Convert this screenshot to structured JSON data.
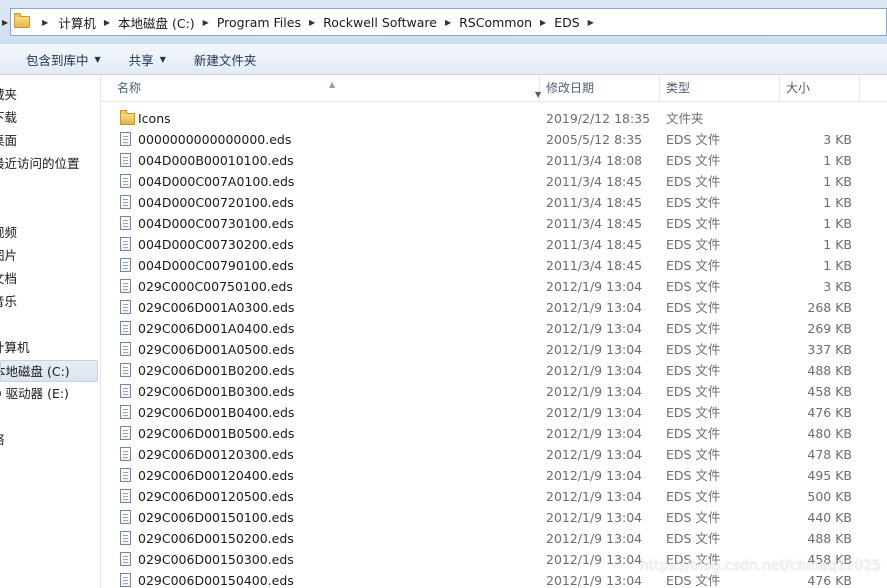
{
  "address": {
    "crumbs": [
      "计算机",
      "本地磁盘 (C:)",
      "Program Files",
      "Rockwell Software",
      "RSCommon",
      "EDS"
    ],
    "icon": "folder-icon"
  },
  "toolbar": {
    "include_library": "包含到库中",
    "share": "共享",
    "new_folder": "新建文件夹"
  },
  "nav": {
    "items": [
      "藏夹",
      "下载",
      "桌面",
      "最近访问的位置",
      "视频",
      "图片",
      "文档",
      "音乐",
      "计算机",
      "本地磁盘 (C:)",
      "D 驱动器 (E:)",
      "络"
    ],
    "selected_index": 9
  },
  "columns": {
    "name": "名称",
    "date": "修改日期",
    "type": "类型",
    "size": "大小"
  },
  "files": [
    {
      "icon": "folder-icon",
      "name": "Icons",
      "date": "2019/2/12 18:35",
      "type": "文件夹",
      "size": ""
    },
    {
      "icon": "file-icon",
      "name": "0000000000000000.eds",
      "date": "2005/5/12 8:35",
      "type": "EDS 文件",
      "size": "3 KB"
    },
    {
      "icon": "file-icon",
      "name": "004D000B00010100.eds",
      "date": "2011/3/4 18:08",
      "type": "EDS 文件",
      "size": "1 KB"
    },
    {
      "icon": "file-icon",
      "name": "004D000C007A0100.eds",
      "date": "2011/3/4 18:45",
      "type": "EDS 文件",
      "size": "1 KB"
    },
    {
      "icon": "file-icon",
      "name": "004D000C00720100.eds",
      "date": "2011/3/4 18:45",
      "type": "EDS 文件",
      "size": "1 KB"
    },
    {
      "icon": "file-icon",
      "name": "004D000C00730100.eds",
      "date": "2011/3/4 18:45",
      "type": "EDS 文件",
      "size": "1 KB"
    },
    {
      "icon": "file-icon",
      "name": "004D000C00730200.eds",
      "date": "2011/3/4 18:45",
      "type": "EDS 文件",
      "size": "1 KB"
    },
    {
      "icon": "file-icon",
      "name": "004D000C00790100.eds",
      "date": "2011/3/4 18:45",
      "type": "EDS 文件",
      "size": "1 KB"
    },
    {
      "icon": "file-icon",
      "name": "029C000C00750100.eds",
      "date": "2012/1/9 13:04",
      "type": "EDS 文件",
      "size": "3 KB"
    },
    {
      "icon": "file-icon",
      "name": "029C006D001A0300.eds",
      "date": "2012/1/9 13:04",
      "type": "EDS 文件",
      "size": "268 KB"
    },
    {
      "icon": "file-icon",
      "name": "029C006D001A0400.eds",
      "date": "2012/1/9 13:04",
      "type": "EDS 文件",
      "size": "269 KB"
    },
    {
      "icon": "file-icon",
      "name": "029C006D001A0500.eds",
      "date": "2012/1/9 13:04",
      "type": "EDS 文件",
      "size": "337 KB"
    },
    {
      "icon": "file-icon",
      "name": "029C006D001B0200.eds",
      "date": "2012/1/9 13:04",
      "type": "EDS 文件",
      "size": "488 KB"
    },
    {
      "icon": "file-icon",
      "name": "029C006D001B0300.eds",
      "date": "2012/1/9 13:04",
      "type": "EDS 文件",
      "size": "458 KB"
    },
    {
      "icon": "file-icon",
      "name": "029C006D001B0400.eds",
      "date": "2012/1/9 13:04",
      "type": "EDS 文件",
      "size": "476 KB"
    },
    {
      "icon": "file-icon",
      "name": "029C006D001B0500.eds",
      "date": "2012/1/9 13:04",
      "type": "EDS 文件",
      "size": "480 KB"
    },
    {
      "icon": "file-icon",
      "name": "029C006D00120300.eds",
      "date": "2012/1/9 13:04",
      "type": "EDS 文件",
      "size": "478 KB"
    },
    {
      "icon": "file-icon",
      "name": "029C006D00120400.eds",
      "date": "2012/1/9 13:04",
      "type": "EDS 文件",
      "size": "495 KB"
    },
    {
      "icon": "file-icon",
      "name": "029C006D00120500.eds",
      "date": "2012/1/9 13:04",
      "type": "EDS 文件",
      "size": "500 KB"
    },
    {
      "icon": "file-icon",
      "name": "029C006D00150100.eds",
      "date": "2012/1/9 13:04",
      "type": "EDS 文件",
      "size": "440 KB"
    },
    {
      "icon": "file-icon",
      "name": "029C006D00150200.eds",
      "date": "2012/1/9 13:04",
      "type": "EDS 文件",
      "size": "488 KB"
    },
    {
      "icon": "file-icon",
      "name": "029C006D00150300.eds",
      "date": "2012/1/9 13:04",
      "type": "EDS 文件",
      "size": "458 KB"
    },
    {
      "icon": "file-icon",
      "name": "029C006D00150400.eds",
      "date": "2012/1/9 13:04",
      "type": "EDS 文件",
      "size": "476 KB"
    }
  ],
  "watermark": "https://blog.csdn.net/chinaq12025"
}
